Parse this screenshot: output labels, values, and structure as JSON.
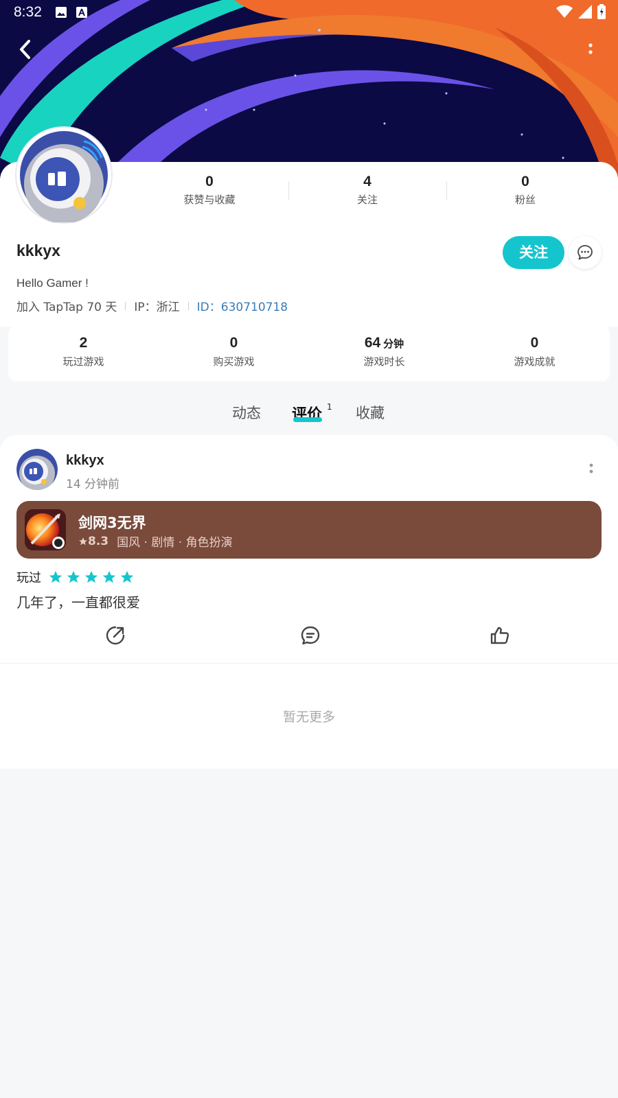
{
  "status_bar": {
    "time": "8:32"
  },
  "profile": {
    "username": "kkkyx",
    "bio": "Hello Gamer !",
    "joined": "加入 TapTap 70 天",
    "ip": "IP：浙江",
    "id": "ID：630710718",
    "follow_label": "关注",
    "stats": [
      {
        "num": "0",
        "label": "获赞与收藏"
      },
      {
        "num": "4",
        "label": "关注"
      },
      {
        "num": "0",
        "label": "粉丝"
      }
    ]
  },
  "game_stats": [
    {
      "num": "2",
      "unit": "",
      "label": "玩过游戏"
    },
    {
      "num": "0",
      "unit": "",
      "label": "购买游戏"
    },
    {
      "num": "64",
      "unit": "分钟",
      "label": "游戏时长"
    },
    {
      "num": "0",
      "unit": "",
      "label": "游戏成就"
    }
  ],
  "tabs": [
    {
      "label": "动态"
    },
    {
      "label": "评价",
      "badge": "1",
      "active": true
    },
    {
      "label": "收藏"
    }
  ],
  "post": {
    "user": "kkkyx",
    "time": "14 分钟前",
    "game": {
      "title": "剑网3无界",
      "rating": "8.3",
      "tags": "国风 · 剧情 · 角色扮演"
    },
    "played_label": "玩过",
    "stars": 5,
    "text": "几年了，一直都很爱"
  },
  "footer": {
    "no_more": "暂无更多"
  },
  "colors": {
    "accent": "#15c5ce",
    "card_bg": "#7a4a3b",
    "id_link": "#3a7cb8"
  },
  "icons": [
    "back-icon",
    "more-vertical-icon",
    "message-icon",
    "share-icon",
    "comment-icon",
    "like-icon",
    "star-icon"
  ]
}
